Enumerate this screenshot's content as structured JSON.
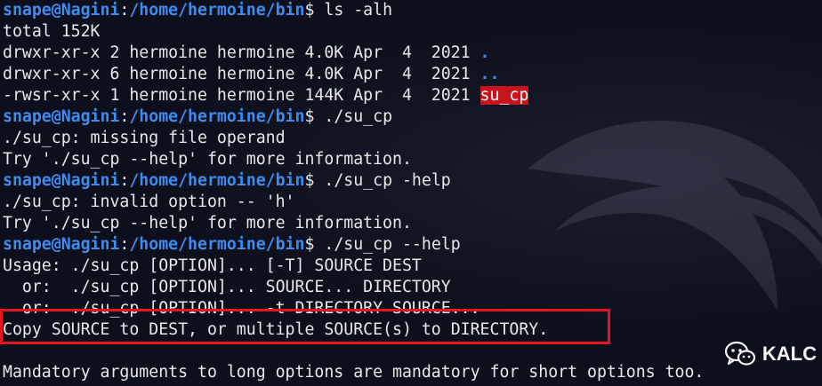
{
  "prompt": {
    "user": "snape",
    "at": "@",
    "host": "Nagini",
    "colon": ":",
    "path": "/home/hermoine/bin",
    "dollar": "$"
  },
  "lines": {
    "l0_cmd": " ls -alh",
    "l1": "total 152K",
    "l2": "drwxr-xr-x 2 hermoine hermoine 4.0K Apr  4  2021 ",
    "l2_name": ".",
    "l3": "drwxr-xr-x 6 hermoine hermoine 4.0K Apr  4  2021 ",
    "l3_name": "..",
    "l4": "-rwsr-xr-x 1 hermoine hermoine 144K Apr  4  2021 ",
    "l4_name": "su_cp",
    "l5_cmd": " ./su_cp",
    "l6": "./su_cp: missing file operand",
    "l7": "Try './su_cp --help' for more information.",
    "l8_cmd": " ./su_cp -help",
    "l9": "./su_cp: invalid option -- 'h'",
    "l10": "Try './su_cp --help' for more information.",
    "l11_cmd": " ./su_cp --help",
    "l12": "Usage: ./su_cp [OPTION]... [-T] SOURCE DEST",
    "l13": "  or:  ./su_cp [OPTION]... SOURCE... DIRECTORY",
    "l14": "  or:  ./su_cp [OPTION]... -t DIRECTORY SOURCE...",
    "l15": "Copy SOURCE to DEST, or multiple SOURCE(s) to DIRECTORY.",
    "l16": "",
    "l17": "Mandatory arguments to long options are mandatory for short options too."
  },
  "badge": {
    "icon": "wechat-icon",
    "label": "KALC"
  },
  "colors": {
    "prompt_blue": "#3f8cf0",
    "text": "#e8e8ea",
    "background": "#0d0f1c",
    "suid_highlight": "#c8141c",
    "annotation_box": "#e3151e"
  }
}
